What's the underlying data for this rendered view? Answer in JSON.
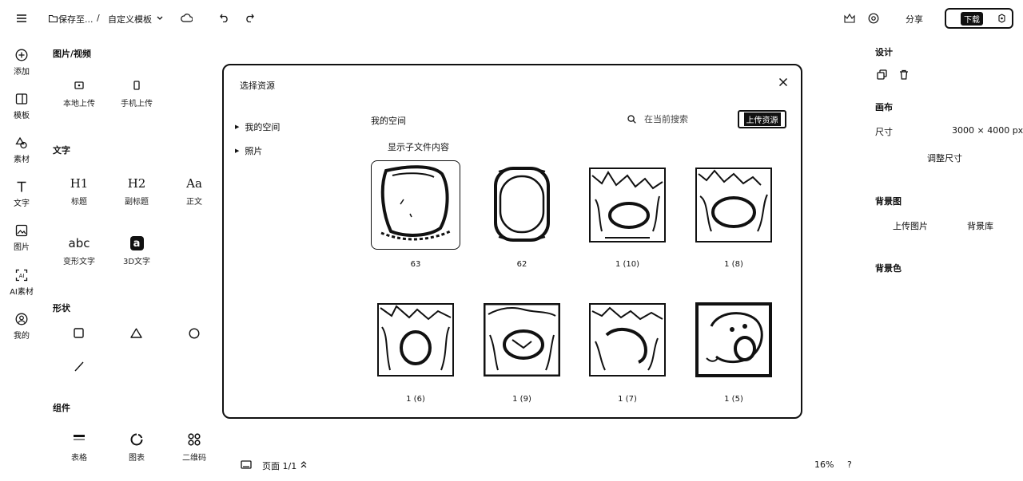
{
  "topbar": {
    "save_label": "保存至...",
    "separator": "/",
    "template_label": "自定义模板",
    "share_label": "分享",
    "download_label": "下载"
  },
  "rail": {
    "items": [
      {
        "label": "添加",
        "icon": "plus-circle-icon"
      },
      {
        "label": "模板",
        "icon": "template-icon"
      },
      {
        "label": "素材",
        "icon": "shapes-icon"
      },
      {
        "label": "文字",
        "icon": "text-icon"
      },
      {
        "label": "图片",
        "icon": "image-icon"
      },
      {
        "label": "AI素材",
        "icon": "ai-icon"
      },
      {
        "label": "我的",
        "icon": "user-icon"
      }
    ]
  },
  "panel": {
    "media_title": "图片/视频",
    "media_tools": [
      {
        "label": "本地上传",
        "icon": "upload-local-icon"
      },
      {
        "label": "手机上传",
        "icon": "phone-upload-icon"
      }
    ],
    "text_title": "文字",
    "text_tools": [
      {
        "glyph": "H1",
        "label": "标题"
      },
      {
        "glyph": "H2",
        "label": "副标题"
      },
      {
        "glyph": "Aa",
        "label": "正文"
      }
    ],
    "text_tools2": [
      {
        "glyph": "abc",
        "label": "变形文字"
      },
      {
        "glyph": "a",
        "label": "3D文字"
      }
    ],
    "shape_title": "形状",
    "component_title": "组件",
    "components": [
      {
        "label": "表格",
        "icon": "table-icon"
      },
      {
        "label": "图表",
        "icon": "chart-icon"
      },
      {
        "label": "二维码",
        "icon": "qr-icon"
      }
    ]
  },
  "dialog": {
    "title": "选择资源",
    "tree": [
      {
        "label": "我的空间"
      },
      {
        "label": "照片"
      }
    ],
    "breadcrumb": "我的空间",
    "search_placeholder": "在当前搜索",
    "upload_label": "上传资源",
    "show_sub_label": "显示子文件内容",
    "items": [
      {
        "label": "63"
      },
      {
        "label": "62"
      },
      {
        "label": "1 (10)"
      },
      {
        "label": "1 (8)"
      },
      {
        "label": "1 (6)"
      },
      {
        "label": "1 (9)"
      },
      {
        "label": "1 (7)"
      },
      {
        "label": "1 (5)"
      }
    ]
  },
  "bottom": {
    "page_label": "页面 1/1",
    "zoom": "16%",
    "help": "?"
  },
  "right": {
    "design_title": "设计",
    "canvas_title": "画布",
    "size_label": "尺寸",
    "size_value": "3000 × 4000 px",
    "resize_label": "调整尺寸",
    "bg_image_title": "背景图",
    "upload_image_label": "上传图片",
    "bg_library_label": "背景库",
    "bg_color_title": "背景色"
  }
}
